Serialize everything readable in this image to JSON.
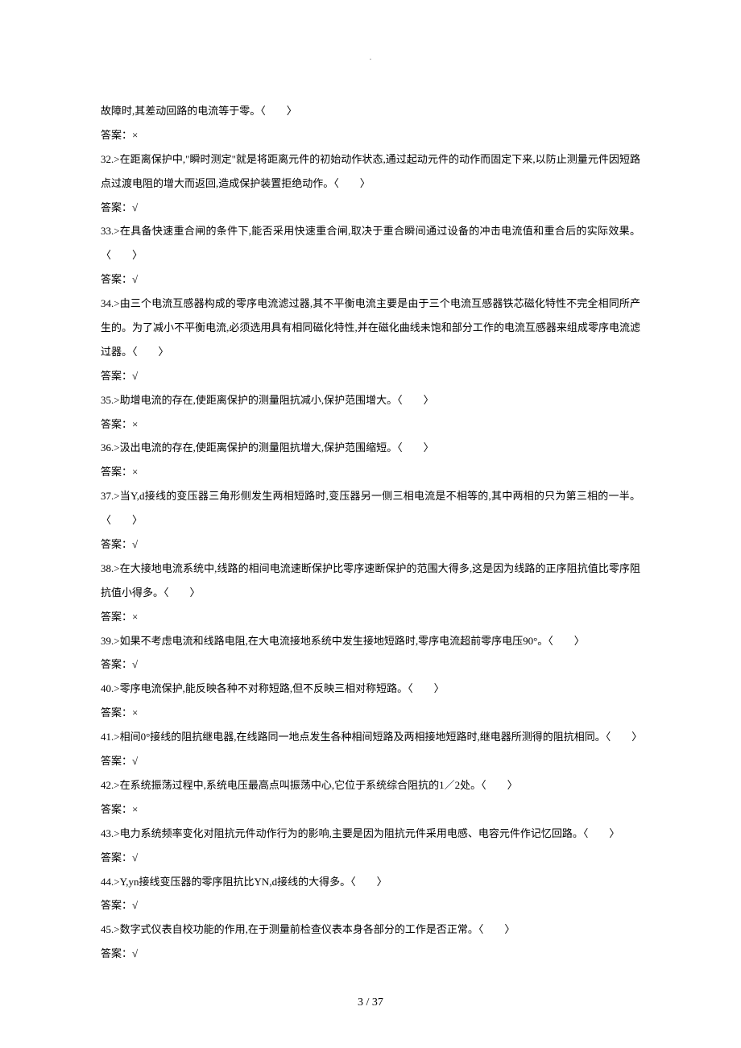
{
  "header_mark": ".",
  "items": [
    {
      "q": "故障时,其差动回路的电流等于零。〈　　〉",
      "a": "答案：×"
    },
    {
      "q": "32.>在距离保护中,\"瞬时测定\"就是将距离元件的初始动作状态,通过起动元件的动作而固定下来,以防止测量元件因短路点过渡电阻的增大而返回,造成保护装置拒绝动作。〈　　〉",
      "a": "答案：√"
    },
    {
      "q": "33.>在具备快速重合闸的条件下,能否采用快速重合闸,取决于重合瞬间通过设备的冲击电流值和重合后的实际效果。〈　　〉",
      "a": "答案：√"
    },
    {
      "q": "34.>由三个电流互感器构成的零序电流滤过器,其不平衡电流主要是由于三个电流互感器铁芯磁化特性不完全相同所产生的。为了减小不平衡电流,必须选用具有相同磁化特性,并在磁化曲线未饱和部分工作的电流互感器来组成零序电流滤过器。〈　　〉",
      "a": "答案：√"
    },
    {
      "q": "35.>助增电流的存在,使距离保护的测量阻抗减小,保护范围增大。〈　　〉",
      "a": "答案：×"
    },
    {
      "q": "36.>汲出电流的存在,使距离保护的测量阻抗增大,保护范围缩短。〈　　〉",
      "a": "答案：×"
    },
    {
      "q": "37.>当Y,d接线的变压器三角形侧发生两相短路时,变压器另一侧三相电流是不相等的,其中两相的只为第三相的一半。〈　　〉",
      "a": "答案：√"
    },
    {
      "q": "38.>在大接地电流系统中,线路的相间电流速断保护比零序速断保护的范围大得多,这是因为线路的正序阻抗值比零序阻抗值小得多。〈　　〉",
      "a": "答案：×"
    },
    {
      "q": "39.>如果不考虑电流和线路电阻,在大电流接地系统中发生接地短路时,零序电流超前零序电压90°。〈　　〉",
      "a": "答案：√"
    },
    {
      "q": "40.>零序电流保护,能反映各种不对称短路,但不反映三相对称短路。〈　　〉",
      "a": "答案：×"
    },
    {
      "q": "41.>相间0°接线的阻抗继电器,在线路同一地点发生各种相间短路及两相接地短路时,继电器所测得的阻抗相同。〈　　〉",
      "a": "答案：√"
    },
    {
      "q": "42.>在系统振荡过程中,系统电压最高点叫振荡中心,它位于系统综合阻抗的1／2处。〈　　〉",
      "a": "答案：×"
    },
    {
      "q": "43.>电力系统频率变化对阻抗元件动作行为的影响,主要是因为阻抗元件采用电感、电容元件作记忆回路。〈　　〉",
      "a": "答案：√"
    },
    {
      "q": "44.>Y,yn接线变压器的零序阻抗比YN,d接线的大得多。〈　　〉",
      "a": "答案：√"
    },
    {
      "q": "45.>数字式仪表自校功能的作用,在于测量前检查仪表本身各部分的工作是否正常。〈　　〉",
      "a": "答案：√"
    }
  ],
  "footer": "3 / 37"
}
